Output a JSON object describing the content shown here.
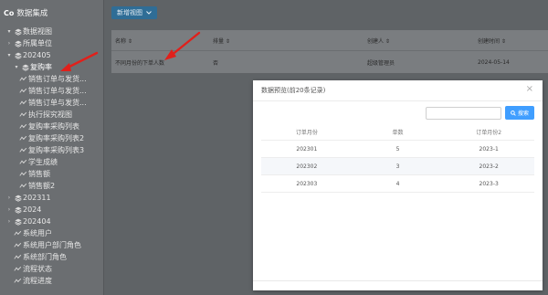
{
  "app": {
    "title": "数据集成"
  },
  "sidebar": {
    "items": [
      {
        "label": "数据视图",
        "level": 0,
        "caret": "▾",
        "icon": "layers-icon"
      },
      {
        "label": "所属单位",
        "level": 1,
        "caret": "›",
        "icon": "layers-icon"
      },
      {
        "label": "202405",
        "level": 1,
        "caret": "▾",
        "icon": "layers-icon"
      },
      {
        "label": "复购率",
        "level": 2,
        "caret": "▾",
        "icon": "layers-icon",
        "selected": true
      },
      {
        "label": "销售订单与发货...",
        "level": 3,
        "caret": "",
        "icon": "view-icon"
      },
      {
        "label": "销售订单与发货...",
        "level": 3,
        "caret": "",
        "icon": "view-icon"
      },
      {
        "label": "销售订单与发货...",
        "level": 3,
        "caret": "",
        "icon": "view-icon"
      },
      {
        "label": "执行探究视图",
        "level": 3,
        "caret": "",
        "icon": "view-icon"
      },
      {
        "label": "复购率采购列表",
        "level": 3,
        "caret": "",
        "icon": "view-icon"
      },
      {
        "label": "复购率采购列表2",
        "level": 3,
        "caret": "",
        "icon": "view-icon"
      },
      {
        "label": "复购率采购列表3",
        "level": 3,
        "caret": "",
        "icon": "view-icon"
      },
      {
        "label": "学生成绩",
        "level": 3,
        "caret": "",
        "icon": "view-icon"
      },
      {
        "label": "销售额",
        "level": 3,
        "caret": "",
        "icon": "view-icon"
      },
      {
        "label": "销售额2",
        "level": 3,
        "caret": "",
        "icon": "view-icon"
      },
      {
        "label": "202311",
        "level": 1,
        "caret": "›",
        "icon": "layers-icon"
      },
      {
        "label": "2024",
        "level": 1,
        "caret": "›",
        "icon": "layers-icon"
      },
      {
        "label": "202404",
        "level": 1,
        "caret": "›",
        "icon": "layers-icon"
      },
      {
        "label": "系统用户",
        "level": 1,
        "caret": "",
        "icon": "view-icon"
      },
      {
        "label": "系统用户部门角色",
        "level": 1,
        "caret": "",
        "icon": "view-icon"
      },
      {
        "label": "系统部门角色",
        "level": 1,
        "caret": "",
        "icon": "view-icon"
      },
      {
        "label": "流程状态",
        "level": 1,
        "caret": "",
        "icon": "view-icon"
      },
      {
        "label": "流程进度",
        "level": 1,
        "caret": "",
        "icon": "view-icon"
      }
    ]
  },
  "toolbar": {
    "new_view_label": "新增视图",
    "new_view_icon": "chevron-down-icon"
  },
  "table": {
    "headers": [
      "名称 ⇕",
      "排量 ⇕",
      "创建人 ⇕",
      "创建时间 ⇕"
    ],
    "rows": [
      [
        "不同月份的下单人数",
        "否",
        "超级管理员",
        "2024-05-14"
      ]
    ]
  },
  "modal": {
    "title": "数据预览(前20条记录)",
    "close_icon": "close-icon",
    "search_value": "",
    "search_button_label": "搜索",
    "search_button_icon": "search-icon",
    "columns": [
      "订单月份",
      "单数",
      "订单月份2"
    ],
    "rows": [
      [
        "202301",
        "5",
        "2023-1"
      ],
      [
        "202302",
        "3",
        "2023-2"
      ],
      [
        "202303",
        "4",
        "2023-3"
      ]
    ]
  },
  "colors": {
    "accent": "#409eff",
    "overlay_sidebar": "#6b6e71",
    "annotation_arrow": "#e0201b"
  }
}
